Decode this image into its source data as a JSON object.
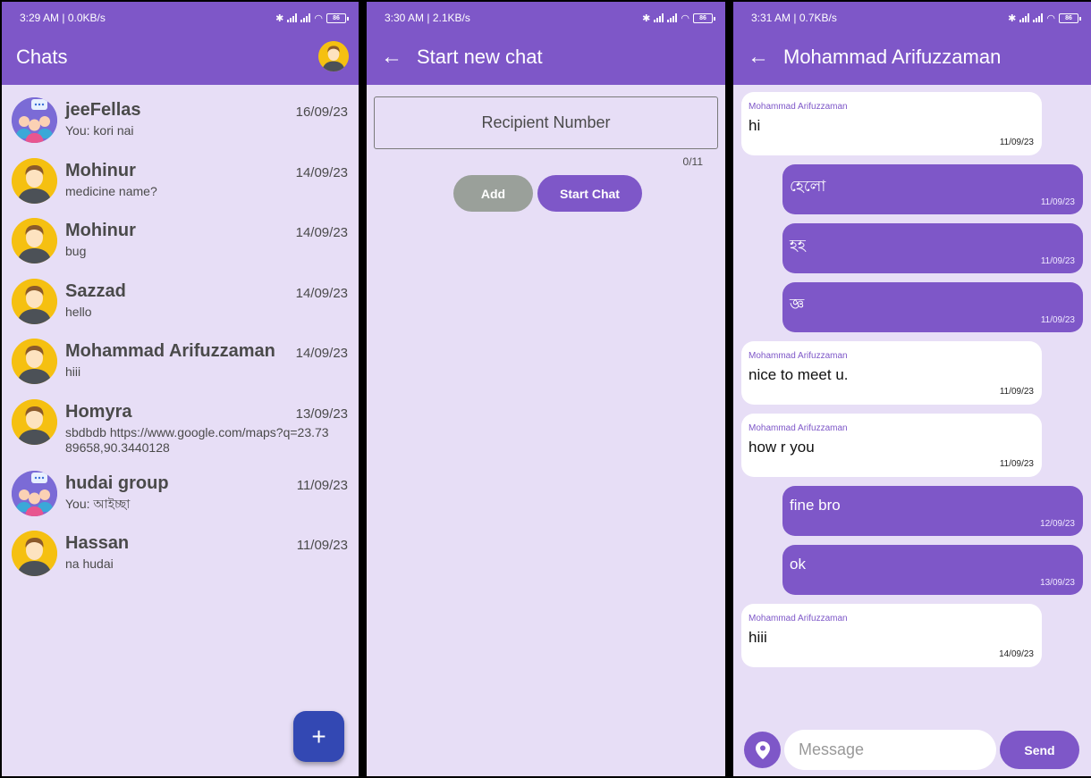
{
  "screen1": {
    "status": {
      "time": "3:29 AM | 0.0KB/s",
      "battery": "86"
    },
    "title": "Chats",
    "chats": [
      {
        "name": "jeeFellas",
        "date": "16/09/23",
        "last": "You: kori nai"
      },
      {
        "name": "Mohinur",
        "date": "14/09/23",
        "last": "medicine name?"
      },
      {
        "name": "Mohinur",
        "date": "14/09/23",
        "last": "bug"
      },
      {
        "name": "Sazzad",
        "date": "14/09/23",
        "last": "hello"
      },
      {
        "name": "Mohammad Arifuzzaman",
        "date": "14/09/23",
        "last": "hiii"
      },
      {
        "name": "Homyra",
        "date": "13/09/23",
        "last": "sbdbdb https://www.google.com/maps?q=23.7389658,90.3440128"
      },
      {
        "name": "hudai group",
        "date": "11/09/23",
        "last": "You: আইচ্ছা"
      },
      {
        "name": "Hassan",
        "date": "11/09/23",
        "last": "na hudai"
      }
    ],
    "fab_label": "+"
  },
  "screen2": {
    "status": {
      "time": "3:30 AM | 2.1KB/s",
      "battery": "86"
    },
    "title": "Start new chat",
    "back": "←",
    "recipient_placeholder": "Recipient Number",
    "counter": "0/11",
    "add_label": "Add",
    "start_label": "Start Chat"
  },
  "screen3": {
    "status": {
      "time": "3:31 AM | 0.7KB/s",
      "battery": "86"
    },
    "title": "Mohammad Arifuzzaman",
    "back": "←",
    "messages": [
      {
        "sender": "Mohammad Arifuzzaman",
        "text": "hi",
        "time": "11/09/23"
      },
      {
        "text": "হেলো",
        "time": "11/09/23"
      },
      {
        "text": "হহ",
        "time": "11/09/23"
      },
      {
        "text": "জ্ঞ",
        "time": "11/09/23"
      },
      {
        "sender": "Mohammad Arifuzzaman",
        "text": "nice to meet u.",
        "time": "11/09/23"
      },
      {
        "sender": "Mohammad Arifuzzaman",
        "text": "how r you",
        "time": "11/09/23"
      },
      {
        "text": "fine bro",
        "time": "12/09/23"
      },
      {
        "text": "ok",
        "time": "13/09/23"
      },
      {
        "sender": "Mohammad Arifuzzaman",
        "text": "hiii",
        "time": "14/09/23"
      }
    ],
    "message_placeholder": "Message",
    "send_label": "Send"
  },
  "colors": {
    "primary": "#7e57c8",
    "background": "#e7def6",
    "fab": "#3348b3",
    "add_button": "#9aa09a",
    "avatar_yellow": "#f5c011"
  }
}
